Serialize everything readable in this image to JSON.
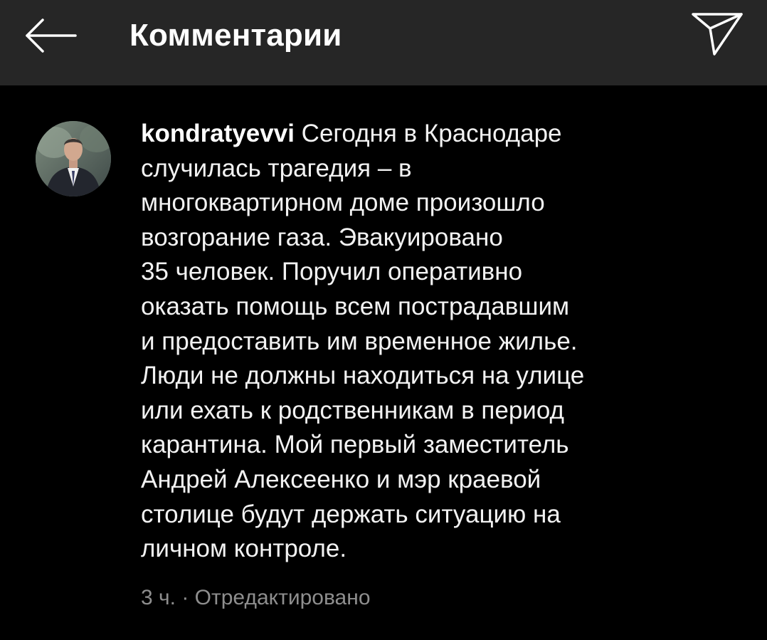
{
  "header": {
    "title": "Комментарии",
    "back_icon": "arrow-left-icon",
    "share_icon": "paper-plane-icon"
  },
  "comment": {
    "username": "kondratyevvi",
    "lines": [
      " Сегодня в Краснодаре",
      "случилась трагедия – в",
      "многоквартирном доме произошло",
      "возгорание газа. Эвакуировано",
      "35 человек. Поручил оперативно",
      "оказать помощь всем пострадавшим",
      "и предоставить им временное жилье.",
      "Люди не должны находиться на улице",
      "или ехать к родственникам в период",
      "карантина. Мой первый заместитель",
      "Андрей Алексеенко и мэр краевой",
      "столице будут держать ситуацию на",
      "личном контроле."
    ],
    "time": "3 ч.",
    "separator": " · ",
    "edited": "Отредактировано"
  },
  "colors": {
    "background": "#000000",
    "header_background": "#262626",
    "text": "#f2f2f2",
    "meta_text": "#8e8e8e"
  }
}
